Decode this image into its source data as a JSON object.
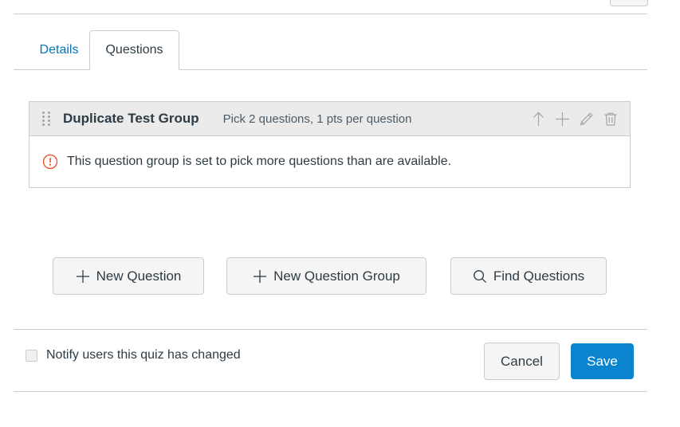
{
  "top": {
    "cut_button_label": ""
  },
  "tabs": [
    {
      "label": "Details",
      "active": false
    },
    {
      "label": "Questions",
      "active": true
    }
  ],
  "question_group": {
    "drag_handle_icon": "drag-handle-icon",
    "title": "Duplicate Test Group",
    "meta": "Pick 2 questions, 1 pts per question",
    "actions": [
      {
        "icon": "arrow-up-icon",
        "label": "Move"
      },
      {
        "icon": "plus-icon",
        "label": "Add"
      },
      {
        "icon": "pencil-icon",
        "label": "Edit"
      },
      {
        "icon": "trash-icon",
        "label": "Delete"
      }
    ],
    "warning": {
      "icon": "warning-circle-icon",
      "text": "This question group is set to pick more questions than are available.",
      "color": "#ef4a25"
    }
  },
  "actions": {
    "new_question": {
      "icon": "plus-icon",
      "label": "New Question"
    },
    "new_question_group": {
      "icon": "plus-icon",
      "label": "New Question Group"
    },
    "find_questions": {
      "icon": "search-icon",
      "label": "Find Questions"
    }
  },
  "footer": {
    "notify_checkbox": {
      "label": "Notify users this quiz has changed",
      "checked": false
    },
    "cancel_label": "Cancel",
    "save_label": "Save",
    "save_color": "#0a84cf"
  }
}
